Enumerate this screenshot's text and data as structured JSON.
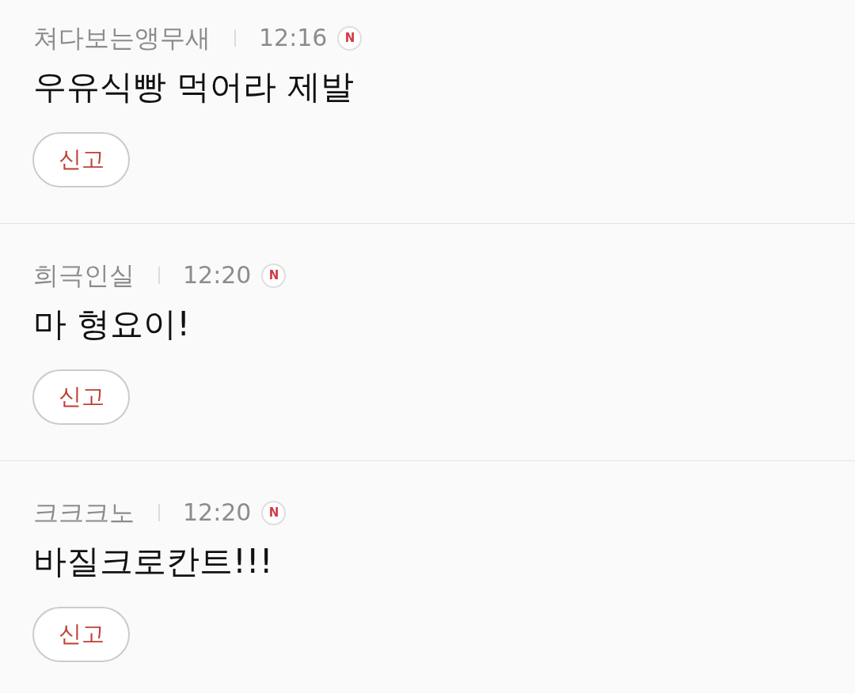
{
  "comments": [
    {
      "author": "쳐다보는앵무새",
      "time": "12:16",
      "badge": "N",
      "text": "우유식빵 먹어라 제발",
      "report_button": "신고"
    },
    {
      "author": "희극인실",
      "time": "12:20",
      "badge": "N",
      "text": "마 형요이!",
      "report_button": "신고"
    },
    {
      "author": "크크크노",
      "time": "12:20",
      "badge": "N",
      "text": "바질크로칸트!!!",
      "report_button": "신고"
    }
  ]
}
